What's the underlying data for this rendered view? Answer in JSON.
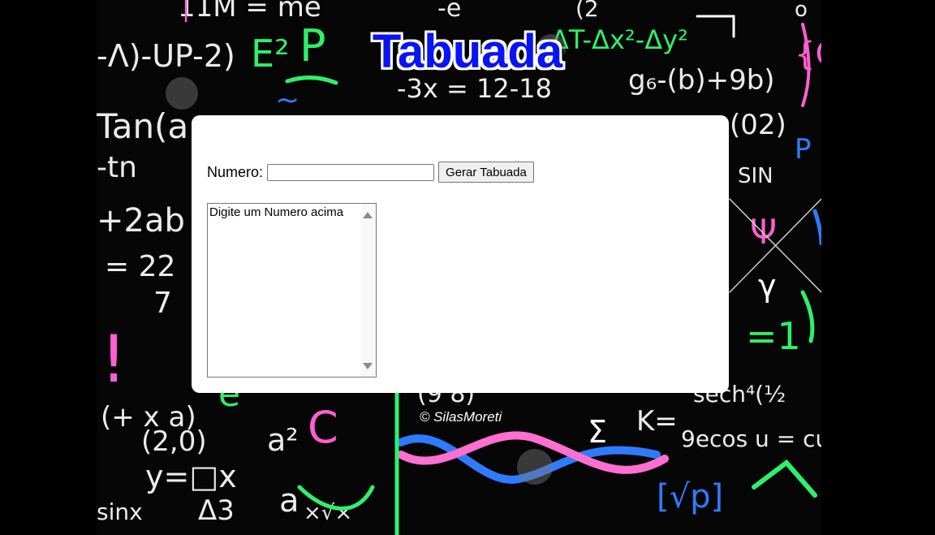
{
  "page": {
    "title": "Tabuada"
  },
  "form": {
    "number_label": "Numero:",
    "number_value": "",
    "generate_button": "Gerar Tabuada",
    "result_placeholder": "Digite um Numero acima"
  },
  "footer": {
    "text": "© SilasMoreti"
  },
  "background": {
    "scribbles": [
      "E²",
      "-ΔT-Δx²-Δy²",
      "-3x = 12-18",
      "g₆-(b)+9b)",
      "tan(a",
      "(02)",
      "-tn",
      "+2ab",
      "= 22/7",
      "(2,0)",
      "a²C",
      "y=□x/Δ3",
      "sinx",
      "9cos u = cu",
      "K=",
      "√p",
      "sech⁴(½",
      "Ψ",
      "γ",
      "SIN",
      "-Λ)-UP-2)",
      "Σ"
    ]
  },
  "colors": {
    "title": "#0a14f0",
    "card": "#ffffff",
    "page_bg": "#000000"
  }
}
